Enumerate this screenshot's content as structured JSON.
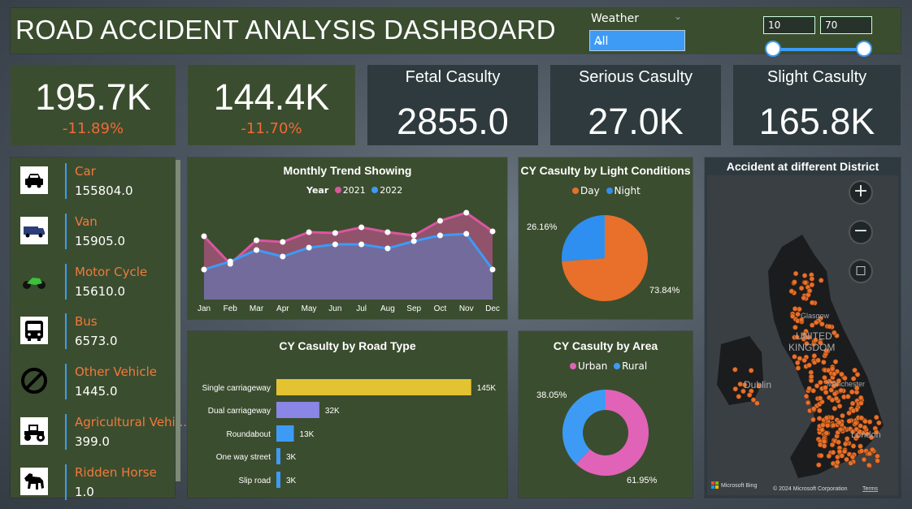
{
  "header": {
    "title": "ROAD ACCIDENT ANALYSIS DASHBOARD"
  },
  "filters": {
    "weather_label": "Weather",
    "weather_value": "All",
    "range_min": "10",
    "range_max": "70",
    "range_low_frac": 0.0,
    "range_high_frac": 1.0
  },
  "kpis": [
    {
      "value": "195.7K",
      "change": "-11.89%"
    },
    {
      "value": "144.4K",
      "change": "-11.70%"
    },
    {
      "title": "Fetal Casulty",
      "value": "2855.0"
    },
    {
      "title": "Serious Casulty",
      "value": "27.0K"
    },
    {
      "title": "Slight Casulty",
      "value": "165.8K"
    }
  ],
  "vehicles": [
    {
      "name": "Car",
      "value": "155804.0",
      "icon": "car-icon"
    },
    {
      "name": "Van",
      "value": "15905.0",
      "icon": "van-icon"
    },
    {
      "name": "Motor Cycle",
      "value": "15610.0",
      "icon": "motorcycle-icon"
    },
    {
      "name": "Bus",
      "value": "6573.0",
      "icon": "bus-icon"
    },
    {
      "name": "Other Vehicle",
      "value": "1445.0",
      "icon": "no-entry-icon"
    },
    {
      "name": "Agricultural Vehi...",
      "value": "399.0",
      "icon": "tractor-icon"
    },
    {
      "name": "Ridden Horse",
      "value": "1.0",
      "icon": "horse-icon"
    }
  ],
  "colors": {
    "y2021": "#d9579f",
    "y2022": "#3d9bf5",
    "day": "#e8702a",
    "night": "#2f8ff0",
    "urban": "#e063b8",
    "rural": "#3d9bf5",
    "bar_single": "#e3c332",
    "bar_dual": "#8a86e6",
    "bar_other": "#3d9bf5",
    "accent_orange": "#f07a3a"
  },
  "chart_data": [
    {
      "type": "area",
      "title": "Monthly Trend Showing",
      "legend_title": "Year",
      "categories": [
        "Jan",
        "Feb",
        "Mar",
        "Apr",
        "May",
        "Jun",
        "Jul",
        "Aug",
        "Sep",
        "Oct",
        "Nov",
        "Dec"
      ],
      "series": [
        {
          "name": "2021",
          "values": [
            11800,
            8400,
            11300,
            11100,
            12300,
            12200,
            12900,
            12300,
            11900,
            13700,
            14700,
            12400
          ]
        },
        {
          "name": "2022",
          "values": [
            7700,
            8700,
            10100,
            9300,
            10400,
            10800,
            10800,
            10300,
            11200,
            11900,
            12100,
            7700
          ]
        }
      ],
      "ylim": [
        4000,
        16000
      ]
    },
    {
      "type": "pie",
      "title": "CY Casulty by Light Conditions",
      "labels": [
        "Day",
        "Night"
      ],
      "values": [
        73.84,
        26.16
      ],
      "data_labels": [
        "73.84%",
        "26.16%"
      ]
    },
    {
      "type": "bar",
      "title": "CY Casulty by Road Type",
      "orientation": "horizontal",
      "categories": [
        "Single carriageway",
        "Dual carriageway",
        "Roundabout",
        "One way street",
        "Slip road"
      ],
      "values": [
        145,
        32,
        13,
        3,
        3
      ],
      "data_labels": [
        "145K",
        "32K",
        "13K",
        "3K",
        "3K"
      ],
      "xlim": [
        0,
        150
      ]
    },
    {
      "type": "pie",
      "title": "CY Casulty by Area",
      "donut": true,
      "labels": [
        "Urban",
        "Rural"
      ],
      "values": [
        61.95,
        38.05
      ],
      "data_labels": [
        "61.95%",
        "38.05%"
      ]
    }
  ],
  "map": {
    "title": "Accident at different District",
    "labels": [
      "UNITED",
      "KINGDOM",
      "Dublin",
      "London",
      "Glasgow",
      "Manchester"
    ],
    "credit": "© 2024 Microsoft Corporation",
    "terms": "Terms",
    "brand": "Microsoft Bing"
  }
}
